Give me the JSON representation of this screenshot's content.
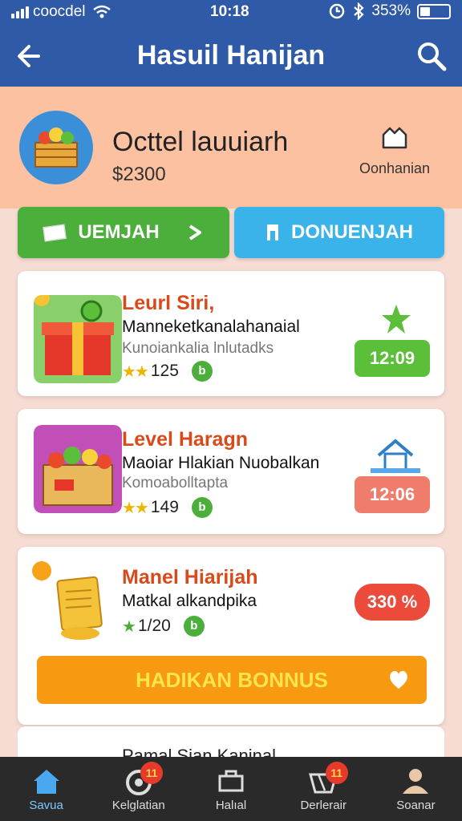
{
  "status_bar": {
    "carrier": "coocdel",
    "time": "10:18",
    "battery": "353%"
  },
  "app_bar": {
    "title": "Hasuil Hanijan"
  },
  "header": {
    "shop_name": "Octtel lauuiarh",
    "price": "$2300",
    "notification_label": "Oonhanian"
  },
  "buttons": {
    "left_label": "UEMJAH",
    "right_label": "DONUENJAH",
    "left_color": "#4caf3c",
    "right_color": "#3ab3ea"
  },
  "cards": [
    {
      "title": "Leurl Siri,",
      "subtitle": "Manneketkanalahanaial",
      "description": "Kunoiankalia lnlutadks",
      "rating": "125",
      "tag": "12:09",
      "tag_color": "#5cbf3a",
      "icon": "star-icon"
    },
    {
      "title": "Level Haragn",
      "subtitle": "Maoiar Hlakian Nuobalkan",
      "description": "Komoabolltapta",
      "rating": "149",
      "tag": "12:06",
      "tag_color": "#f07c6c",
      "icon": "house-icon"
    },
    {
      "title": "Manel Hiarijah",
      "subtitle": "Matkal alkandpika",
      "rating": "1/20",
      "tag": "330 %",
      "tag_color": "#ec4a3a",
      "bonus_label": "HADIKAN BONNUS"
    }
  ],
  "partial_card": {
    "title": "Pamal Sian Kaninal"
  },
  "bottom_nav": [
    {
      "label": "Savua",
      "icon": "home-icon",
      "active": true
    },
    {
      "label": "Kelglatian",
      "icon": "wallet-icon",
      "badge": "11"
    },
    {
      "label": "Halıal",
      "icon": "cart-icon"
    },
    {
      "label": "Derlerair",
      "icon": "basket-icon",
      "badge": "11"
    },
    {
      "label": "Soanar",
      "icon": "profile-icon"
    }
  ]
}
